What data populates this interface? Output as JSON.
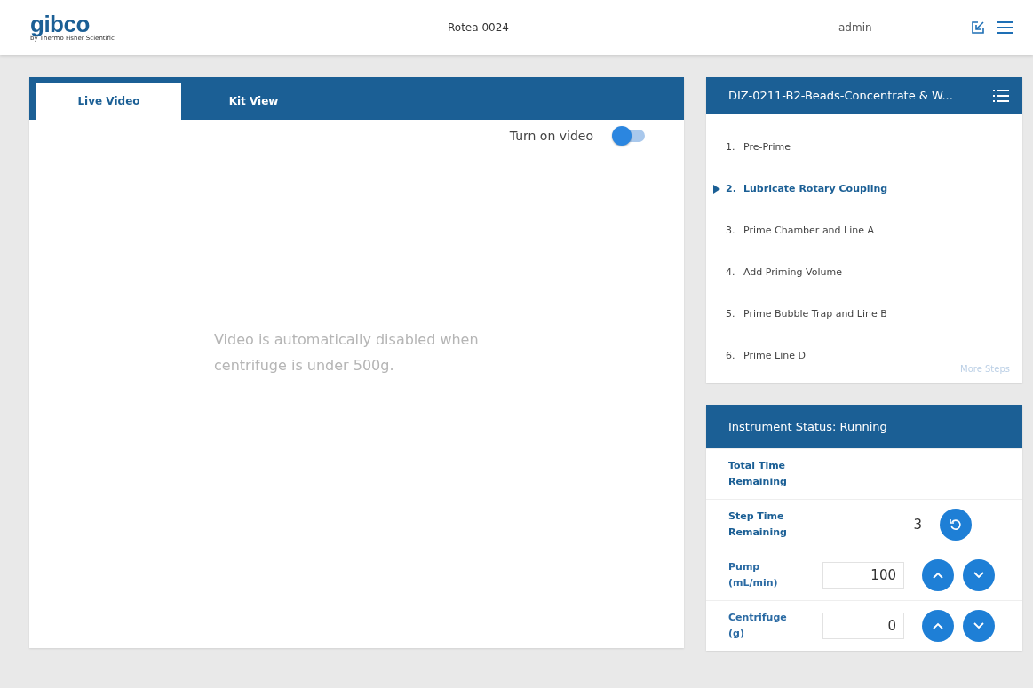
{
  "header": {
    "brand": "gibco",
    "brand_sub": "by Thermo Fisher Scientific",
    "device": "Rotea 0024",
    "user": "admin"
  },
  "video_panel": {
    "tabs": [
      {
        "label": "Live Video",
        "selected": true
      },
      {
        "label": "Kit View",
        "selected": false
      }
    ],
    "toggle": {
      "label": "Turn on video",
      "on": true
    },
    "message": "Video is automatically disabled when centrifuge is under 500g."
  },
  "protocol": {
    "title": "DIZ-0211-B2-Beads-Concentrate & W...",
    "steps": [
      {
        "number": "1.",
        "label": "Pre-Prime",
        "selected": false
      },
      {
        "number": "2.",
        "label": "Lubricate Rotary Coupling",
        "selected": true
      },
      {
        "number": "3.",
        "label": "Prime Chamber and Line A",
        "selected": false
      },
      {
        "number": "4.",
        "label": "Add Priming Volume",
        "selected": false
      },
      {
        "number": "5.",
        "label": "Prime Bubble Trap and Line B",
        "selected": false
      },
      {
        "number": "6.",
        "label": "Prime Line D",
        "selected": false
      }
    ],
    "more_link": "More Steps"
  },
  "status": {
    "title": "Instrument Status: Running",
    "rows": [
      {
        "kind": "readout",
        "label": "Total Time Remaining"
      },
      {
        "kind": "readout",
        "label": "Step Time Remaining",
        "value": "3",
        "buttons": [
          {
            "kind": "reset"
          }
        ]
      },
      {
        "kind": "input",
        "label": "Pump (mL/min)",
        "value": "100",
        "buttons": [
          {
            "kind": "up"
          },
          {
            "kind": "down"
          }
        ]
      },
      {
        "kind": "input",
        "label": "Centrifuge (g)",
        "value": "0",
        "buttons": [
          {
            "kind": "up"
          },
          {
            "kind": "down"
          }
        ]
      }
    ]
  }
}
